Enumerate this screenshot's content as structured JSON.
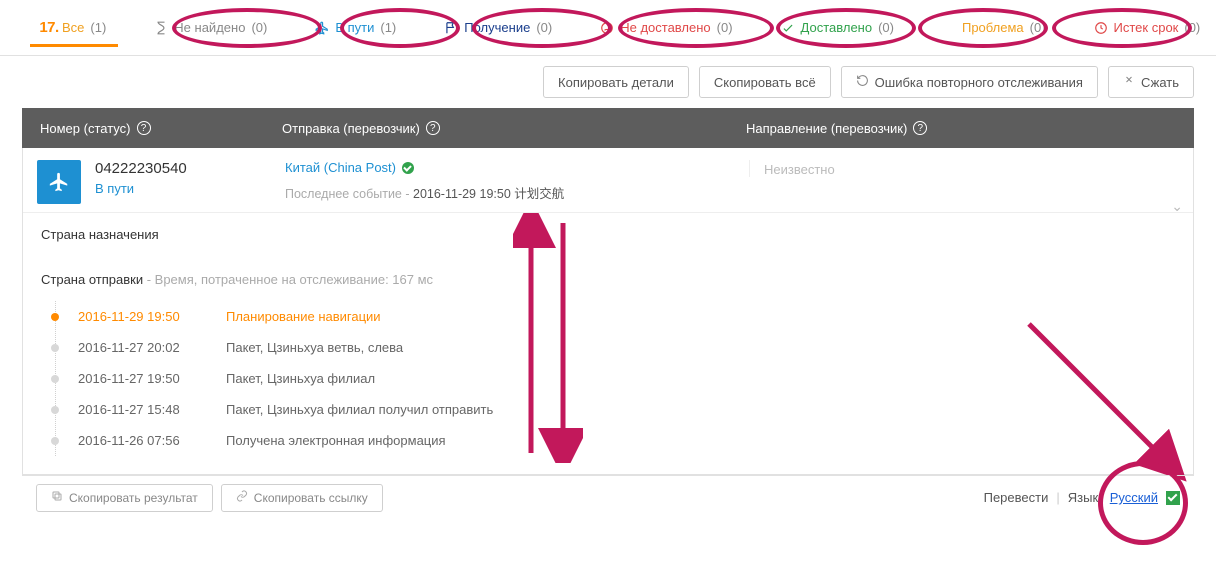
{
  "tabs": [
    {
      "key": "all",
      "label": "Все",
      "count": "(1)",
      "icon": "logo17",
      "color": "clr-orange",
      "active": true
    },
    {
      "key": "notfound",
      "label": "Не найдено",
      "count": "(0)",
      "icon": "hourglass",
      "color": "clr-gray"
    },
    {
      "key": "intransit",
      "label": "В пути",
      "count": "(1)",
      "icon": "plane",
      "color": "clr-blue"
    },
    {
      "key": "pickup",
      "label": "Получение",
      "count": "(0)",
      "icon": "flag",
      "color": "clr-navy"
    },
    {
      "key": "undelivered",
      "label": "Не доставлено",
      "count": "(0)",
      "icon": "sad",
      "color": "clr-red"
    },
    {
      "key": "delivered",
      "label": "Доставлено",
      "count": "(0)",
      "icon": "check",
      "color": "clr-green"
    },
    {
      "key": "exception",
      "label": "Проблема",
      "count": "(0)",
      "icon": "warn",
      "color": "clr-orange"
    },
    {
      "key": "expired",
      "label": "Истек срок",
      "count": "(0)",
      "icon": "clock",
      "color": "clr-red"
    }
  ],
  "actions": {
    "copy_details": "Копировать детали",
    "copy_all": "Скопировать всё",
    "retrack_err": "Ошибка повторного отслеживания",
    "collapse": "Сжать"
  },
  "grid_head": {
    "col1": "Номер (статус)",
    "col2": "Отправка (перевозчик)",
    "col3": "Направление (перевозчик)"
  },
  "row": {
    "number": "04222230540",
    "status": "В пути",
    "carrier_display": "Китай (China Post)",
    "last_event_label": "Последнее событие -",
    "last_event_value": "2016-11-29 19:50 计划交航",
    "destination": "Неизвестно"
  },
  "details": {
    "dest_country_label": "Страна назначения",
    "origin_country_label": "Страна отправки",
    "time_spent_label": "- Время, потраченное на отслеживание: 167 мс",
    "events": [
      {
        "ts": "2016-11-29 19:50",
        "txt": "Планирование навигации",
        "first": true
      },
      {
        "ts": "2016-11-27 20:02",
        "txt": "Пакет, Цзиньхуа ветвь, слева"
      },
      {
        "ts": "2016-11-27 19:50",
        "txt": "Пакет, Цзиньхуа филиал"
      },
      {
        "ts": "2016-11-27 15:48",
        "txt": "Пакет, Цзиньхуа филиал получил отправить"
      },
      {
        "ts": "2016-11-26 07:56",
        "txt": "Получена электронная информация"
      }
    ]
  },
  "footer": {
    "copy_result": "Скопировать результат",
    "copy_link": "Скопировать ссылку",
    "translate": "Перевести",
    "lang_label": "Язык:",
    "lang_value": "Русский"
  },
  "colors": {
    "brand_orange": "#ff8a00",
    "accent_pink": "#c2185b",
    "link_blue": "#1e90d2",
    "ok_green": "#31a24c"
  }
}
